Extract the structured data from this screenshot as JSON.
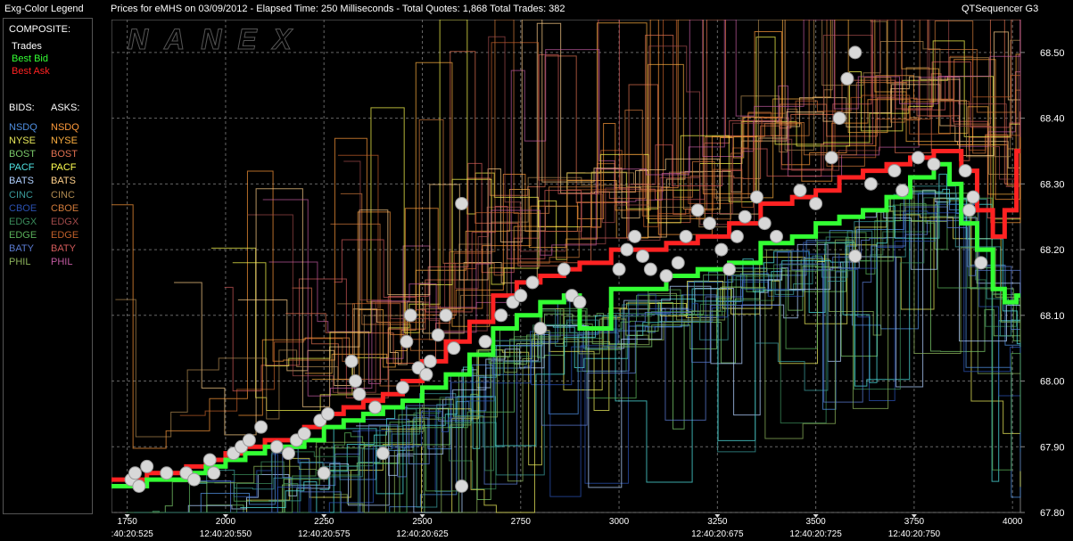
{
  "window": {
    "legend_title": "Exg-Color Legend",
    "chart_title": "Prices for  eMHS  on  03/09/2012  -  Elapsed Time: 250 Milliseconds  -  Total Quotes: 1,868  Total Trades: 382",
    "app_name": "QTSequencer G3",
    "watermark": "NANEX"
  },
  "legend": {
    "composite_header": "COMPOSITE:",
    "composite": [
      {
        "label": "Trades",
        "color": "#ffffff"
      },
      {
        "label": "Best Bid",
        "color": "#33ff33"
      },
      {
        "label": "Best Ask",
        "color": "#ff2222"
      }
    ],
    "bids_header": "BIDS:",
    "asks_header": "ASKS:",
    "exchanges": [
      {
        "bid": "NSDQ",
        "ask": "NSDQ",
        "bid_color": "#4f8fe0",
        "ask_color": "#ff9a3a"
      },
      {
        "bid": "NYSE",
        "ask": "NYSE",
        "bid_color": "#e8e85a",
        "ask_color": "#ffb040"
      },
      {
        "bid": "BOST",
        "ask": "BOST",
        "bid_color": "#7ac86a",
        "ask_color": "#e07050"
      },
      {
        "bid": "PACF",
        "ask": "PACF",
        "bid_color": "#4fe0e0",
        "ask_color": "#ffff50"
      },
      {
        "bid": "BATS",
        "ask": "BATS",
        "bid_color": "#b0d0ff",
        "ask_color": "#ffd08a"
      },
      {
        "bid": "CINC",
        "ask": "CINC",
        "bid_color": "#3a9a9a",
        "ask_color": "#b08a50"
      },
      {
        "bid": "CBOE",
        "ask": "CBOE",
        "bid_color": "#2a50b0",
        "ask_color": "#d07a3a"
      },
      {
        "bid": "EDGX",
        "ask": "EDGX",
        "bid_color": "#3a8a5a",
        "ask_color": "#a04a4a"
      },
      {
        "bid": "EDGE",
        "ask": "EDGE",
        "bid_color": "#5ab05a",
        "ask_color": "#c0602a"
      },
      {
        "bid": "BATY",
        "ask": "BATY",
        "bid_color": "#5a7ad0",
        "ask_color": "#d05a5a"
      },
      {
        "bid": "PHIL",
        "ask": "PHIL",
        "bid_color": "#8ab05a",
        "ask_color": "#c05aa0"
      }
    ]
  },
  "chart_data": {
    "type": "scatter",
    "xlim": [
      1710,
      4020
    ],
    "ylim": [
      67.8,
      68.55
    ],
    "x_ticks": [
      1750,
      2000,
      2250,
      2500,
      2750,
      3000,
      3250,
      3500,
      3750,
      4000
    ],
    "y_ticks": [
      67.8,
      67.9,
      68.0,
      68.1,
      68.2,
      68.3,
      68.4,
      68.5
    ],
    "y_tick_labels": [
      "67.80",
      "67.90",
      "68.00",
      "68.10",
      "68.20",
      "68.30",
      "68.40",
      "68.50"
    ],
    "time_labels": [
      {
        "x": 1750,
        "text": "12:40:20:525"
      },
      {
        "x": 2000,
        "text": "12:40:20:550"
      },
      {
        "x": 2250,
        "text": "12:40:20:575"
      },
      {
        "x": 2500,
        "text": "12:40:20:625"
      },
      {
        "x": 3250,
        "text": "12:40:20:675"
      },
      {
        "x": 3500,
        "text": "12:40:20:725"
      },
      {
        "x": 3750,
        "text": "12:40:20:750"
      }
    ],
    "grid": true,
    "best_bid": [
      [
        1710,
        67.84
      ],
      [
        1800,
        67.85
      ],
      [
        1900,
        67.86
      ],
      [
        1950,
        67.87
      ],
      [
        2000,
        67.88
      ],
      [
        2050,
        67.89
      ],
      [
        2100,
        67.9
      ],
      [
        2200,
        67.91
      ],
      [
        2250,
        67.93
      ],
      [
        2300,
        67.94
      ],
      [
        2350,
        67.95
      ],
      [
        2400,
        67.96
      ],
      [
        2450,
        67.97
      ],
      [
        2500,
        67.99
      ],
      [
        2560,
        68.01
      ],
      [
        2620,
        68.04
      ],
      [
        2680,
        68.08
      ],
      [
        2740,
        68.1
      ],
      [
        2800,
        68.12
      ],
      [
        2860,
        68.13
      ],
      [
        2900,
        68.08
      ],
      [
        2980,
        68.14
      ],
      [
        3060,
        68.14
      ],
      [
        3120,
        68.16
      ],
      [
        3200,
        68.17
      ],
      [
        3280,
        68.18
      ],
      [
        3360,
        68.21
      ],
      [
        3440,
        68.22
      ],
      [
        3500,
        68.24
      ],
      [
        3560,
        68.25
      ],
      [
        3620,
        68.26
      ],
      [
        3680,
        68.28
      ],
      [
        3740,
        68.31
      ],
      [
        3800,
        68.33
      ],
      [
        3840,
        68.3
      ],
      [
        3870,
        68.24
      ],
      [
        3910,
        68.2
      ],
      [
        3950,
        68.14
      ],
      [
        3980,
        68.12
      ],
      [
        4010,
        68.13
      ]
    ],
    "best_ask": [
      [
        1710,
        67.85
      ],
      [
        1800,
        67.86
      ],
      [
        1900,
        67.87
      ],
      [
        1950,
        67.88
      ],
      [
        2000,
        67.89
      ],
      [
        2050,
        67.9
      ],
      [
        2100,
        67.91
      ],
      [
        2200,
        67.93
      ],
      [
        2250,
        67.95
      ],
      [
        2300,
        67.96
      ],
      [
        2350,
        67.97
      ],
      [
        2400,
        67.98
      ],
      [
        2450,
        68.0
      ],
      [
        2500,
        68.03
      ],
      [
        2560,
        68.06
      ],
      [
        2620,
        68.09
      ],
      [
        2680,
        68.13
      ],
      [
        2740,
        68.15
      ],
      [
        2800,
        68.16
      ],
      [
        2860,
        68.17
      ],
      [
        2900,
        68.18
      ],
      [
        2980,
        68.2
      ],
      [
        3060,
        68.2
      ],
      [
        3120,
        68.21
      ],
      [
        3200,
        68.22
      ],
      [
        3280,
        68.24
      ],
      [
        3360,
        68.27
      ],
      [
        3440,
        68.28
      ],
      [
        3500,
        68.29
      ],
      [
        3560,
        68.31
      ],
      [
        3620,
        68.32
      ],
      [
        3680,
        68.33
      ],
      [
        3740,
        68.34
      ],
      [
        3800,
        68.35
      ],
      [
        3840,
        68.35
      ],
      [
        3870,
        68.32
      ],
      [
        3910,
        68.26
      ],
      [
        3950,
        68.22
      ],
      [
        3980,
        68.26
      ],
      [
        4010,
        68.35
      ]
    ],
    "trades": [
      [
        1760,
        67.85
      ],
      [
        1770,
        67.86
      ],
      [
        1780,
        67.84
      ],
      [
        1800,
        67.87
      ],
      [
        1850,
        67.86
      ],
      [
        1900,
        67.86
      ],
      [
        1920,
        67.85
      ],
      [
        1960,
        67.88
      ],
      [
        1970,
        67.86
      ],
      [
        2020,
        67.89
      ],
      [
        2040,
        67.9
      ],
      [
        2060,
        67.91
      ],
      [
        2090,
        67.93
      ],
      [
        2130,
        67.9
      ],
      [
        2160,
        67.89
      ],
      [
        2180,
        67.91
      ],
      [
        2200,
        67.92
      ],
      [
        2240,
        67.94
      ],
      [
        2260,
        67.95
      ],
      [
        2250,
        67.86
      ],
      [
        2320,
        68.03
      ],
      [
        2330,
        68.0
      ],
      [
        2340,
        67.98
      ],
      [
        2380,
        67.96
      ],
      [
        2400,
        67.89
      ],
      [
        2450,
        67.99
      ],
      [
        2460,
        68.06
      ],
      [
        2470,
        68.1
      ],
      [
        2490,
        68.02
      ],
      [
        2510,
        68.01
      ],
      [
        2520,
        68.03
      ],
      [
        2540,
        68.07
      ],
      [
        2560,
        68.1
      ],
      [
        2580,
        68.05
      ],
      [
        2600,
        68.27
      ],
      [
        2600,
        67.84
      ],
      [
        2660,
        68.06
      ],
      [
        2700,
        68.1
      ],
      [
        2730,
        68.12
      ],
      [
        2750,
        68.13
      ],
      [
        2780,
        68.15
      ],
      [
        2800,
        68.08
      ],
      [
        2860,
        68.17
      ],
      [
        2880,
        68.13
      ],
      [
        2900,
        68.12
      ],
      [
        3000,
        68.17
      ],
      [
        3020,
        68.2
      ],
      [
        3040,
        68.22
      ],
      [
        3060,
        68.19
      ],
      [
        3080,
        68.17
      ],
      [
        3120,
        68.16
      ],
      [
        3150,
        68.18
      ],
      [
        3170,
        68.22
      ],
      [
        3200,
        68.26
      ],
      [
        3230,
        68.24
      ],
      [
        3260,
        68.2
      ],
      [
        3280,
        68.17
      ],
      [
        3300,
        68.22
      ],
      [
        3320,
        68.25
      ],
      [
        3350,
        68.28
      ],
      [
        3370,
        68.24
      ],
      [
        3400,
        68.22
      ],
      [
        3460,
        68.29
      ],
      [
        3500,
        68.27
      ],
      [
        3540,
        68.34
      ],
      [
        3560,
        68.4
      ],
      [
        3580,
        68.46
      ],
      [
        3600,
        68.5
      ],
      [
        3600,
        68.19
      ],
      [
        3640,
        68.3
      ],
      [
        3700,
        68.32
      ],
      [
        3720,
        68.29
      ],
      [
        3760,
        68.34
      ],
      [
        3800,
        68.33
      ],
      [
        3880,
        68.32
      ],
      [
        3890,
        68.26
      ],
      [
        3900,
        68.28
      ],
      [
        3920,
        68.18
      ]
    ]
  }
}
